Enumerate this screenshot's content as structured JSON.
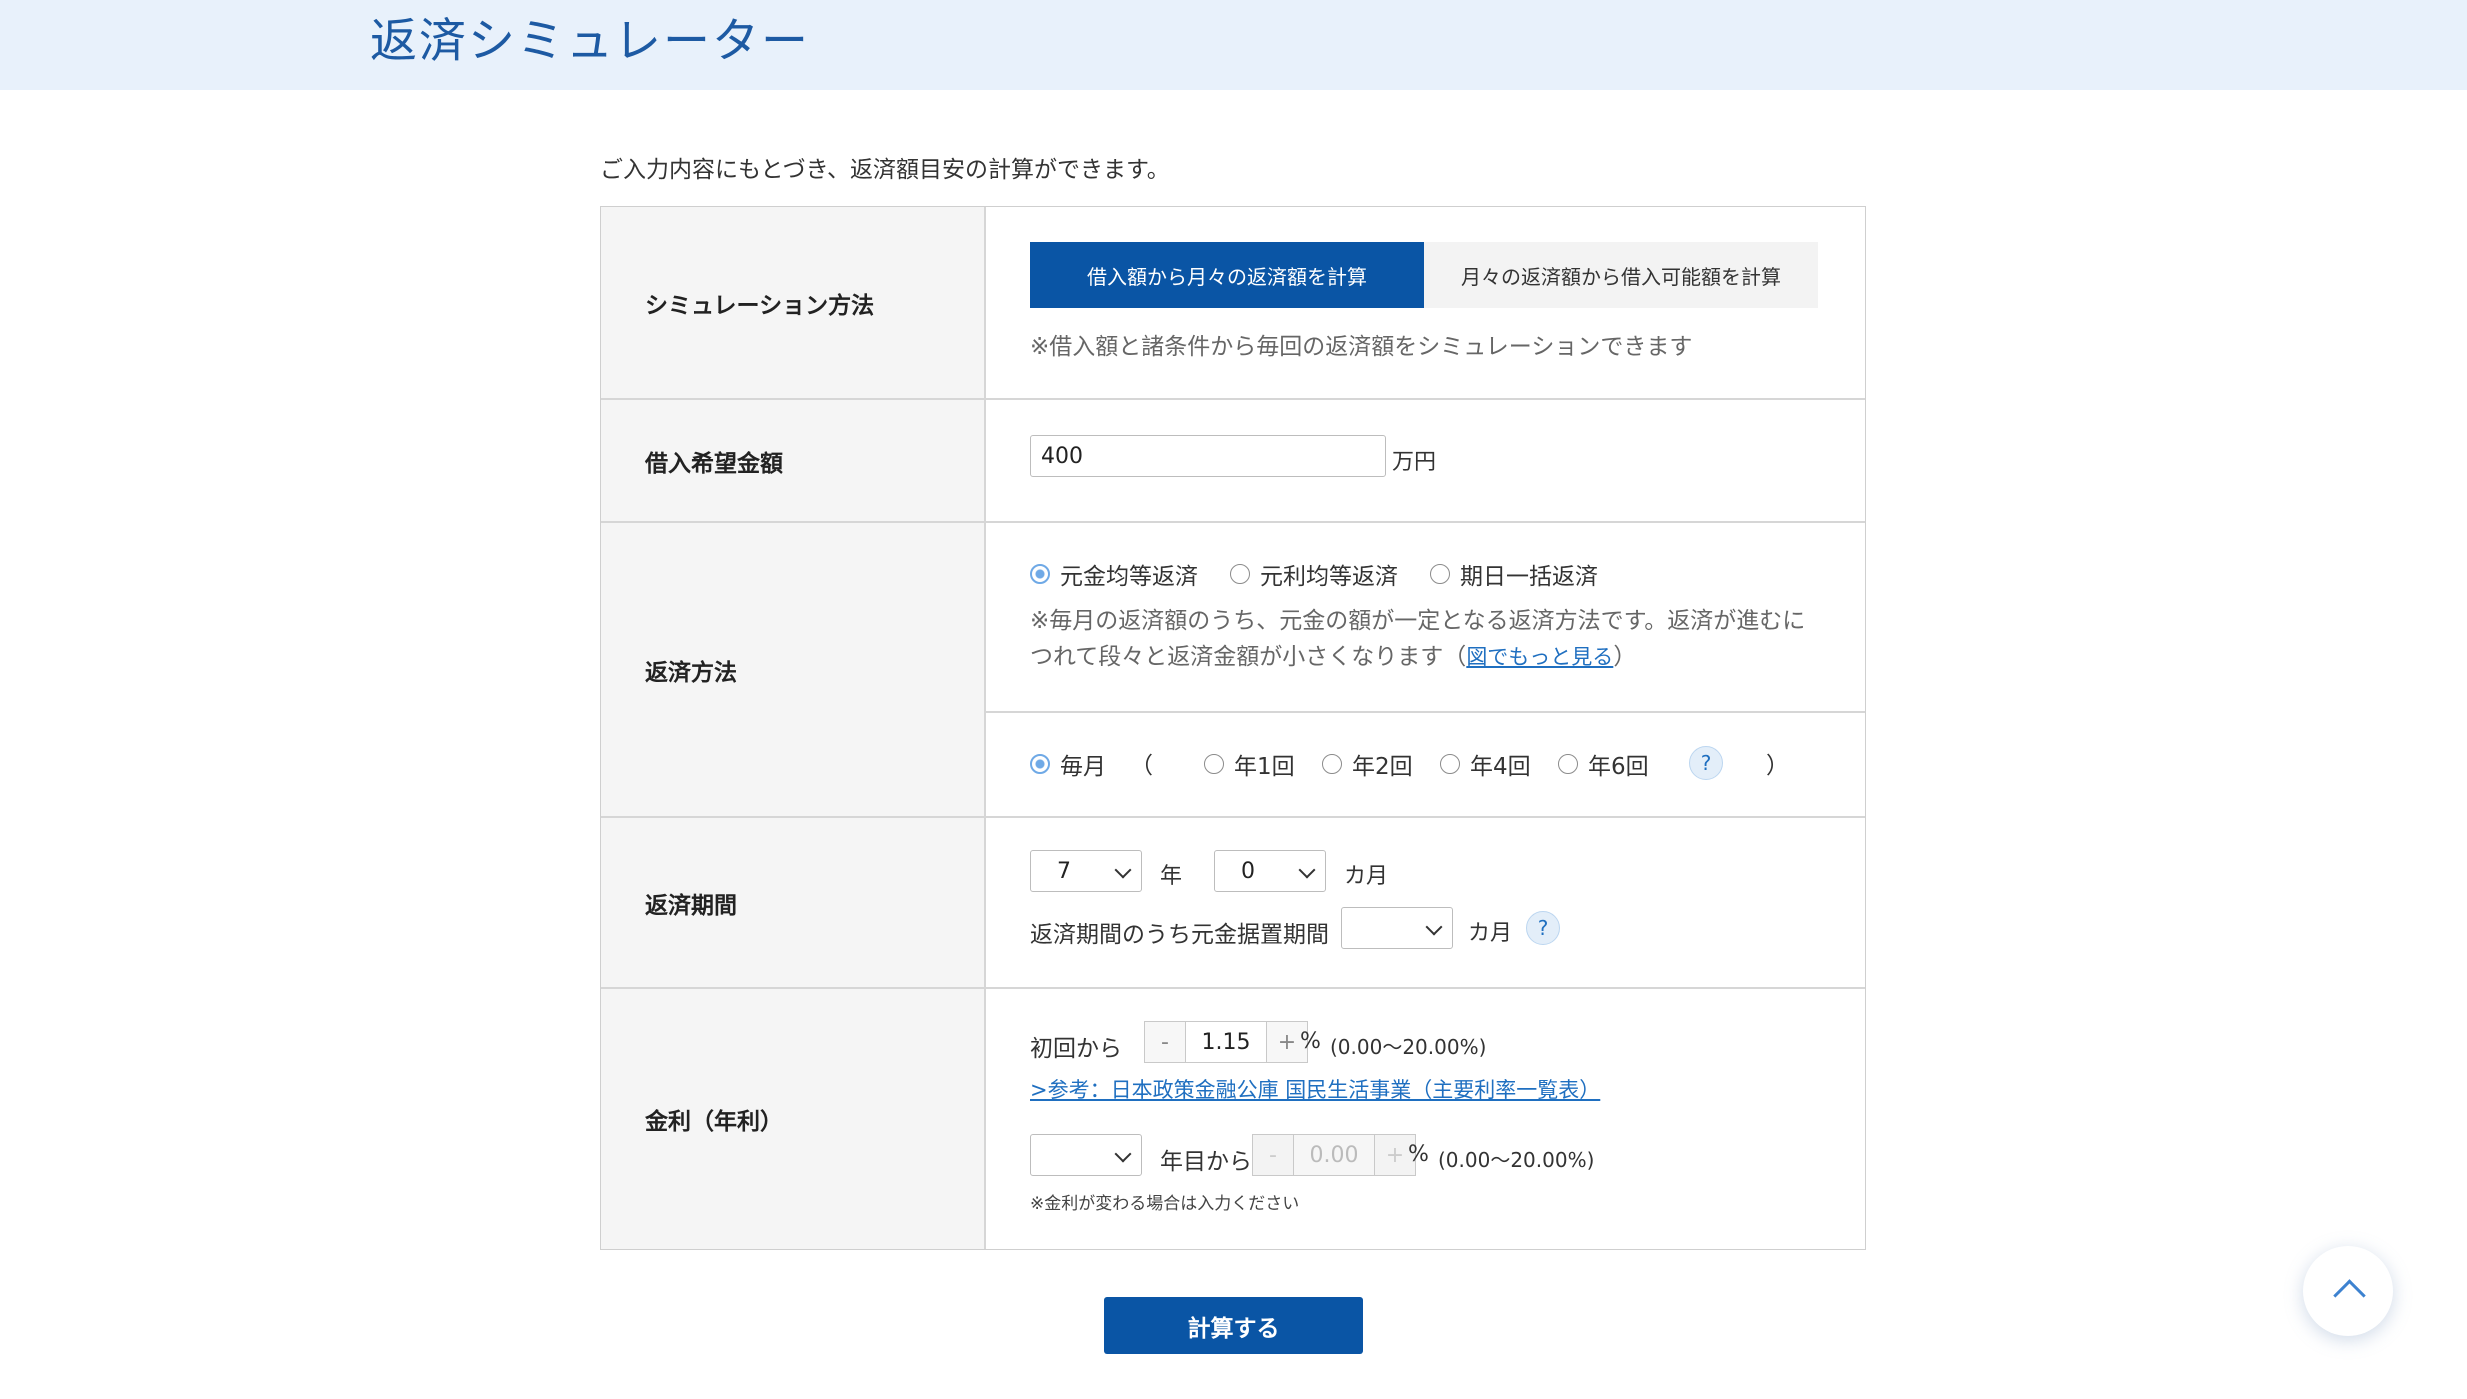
{
  "header": {
    "title": "返済シミュレーター"
  },
  "intro": "ご入力内容にもとづき、返済額目安の計算ができます。",
  "sim_method": {
    "label": "シミュレーション方法",
    "tab_active": "借入額から月々の返済額を計算",
    "tab_inactive": "月々の返済額から借入可能額を計算",
    "note": "※借入額と諸条件から毎回の返済額をシミュレーションできます"
  },
  "loan_amount": {
    "label": "借入希望金額",
    "value": "400",
    "unit": "万円"
  },
  "repay_method": {
    "label": "返済方法",
    "options": [
      "元金均等返済",
      "元利均等返済",
      "期日一括返済"
    ],
    "selected": "元金均等返済",
    "note_line1": "※毎月の返済額のうち、元金の額が一定となる返済方法です。返済が進むに",
    "note_line2_pre": "つれて段々と返済金額が小さくなります（",
    "note_link": "図でもっと見る",
    "note_line2_post": "）",
    "freq_monthly": "毎月",
    "paren_open": "（",
    "paren_close": "）",
    "freq_options": [
      "年1回",
      "年2回",
      "年4回",
      "年6回"
    ],
    "help": "?"
  },
  "period": {
    "label": "返済期間",
    "years_value": "7",
    "years_unit": "年",
    "months_value": "0",
    "months_unit": "カ月",
    "grace_label": "返済期間のうち元金据置期間",
    "grace_value": "",
    "grace_unit": "カ月",
    "help": "?"
  },
  "interest": {
    "label": "金利（年利）",
    "first_label": "初回から",
    "minus": "-",
    "plus": "+",
    "first_value": "1.15",
    "percent": "%",
    "range": "(0.00〜20.00%)",
    "ref_link": ">参考：日本政策金融公庫 国民生活事業（主要利率一覧表）",
    "year_select_value": "",
    "year_label": "年目から",
    "second_value": "0.00",
    "note": "※金利が変わる場合は入力ください"
  },
  "submit_label": "計算する",
  "colors": {
    "brand": "#0a55a5",
    "header_bg": "#e8f1fb",
    "link": "#1f6fc0"
  }
}
